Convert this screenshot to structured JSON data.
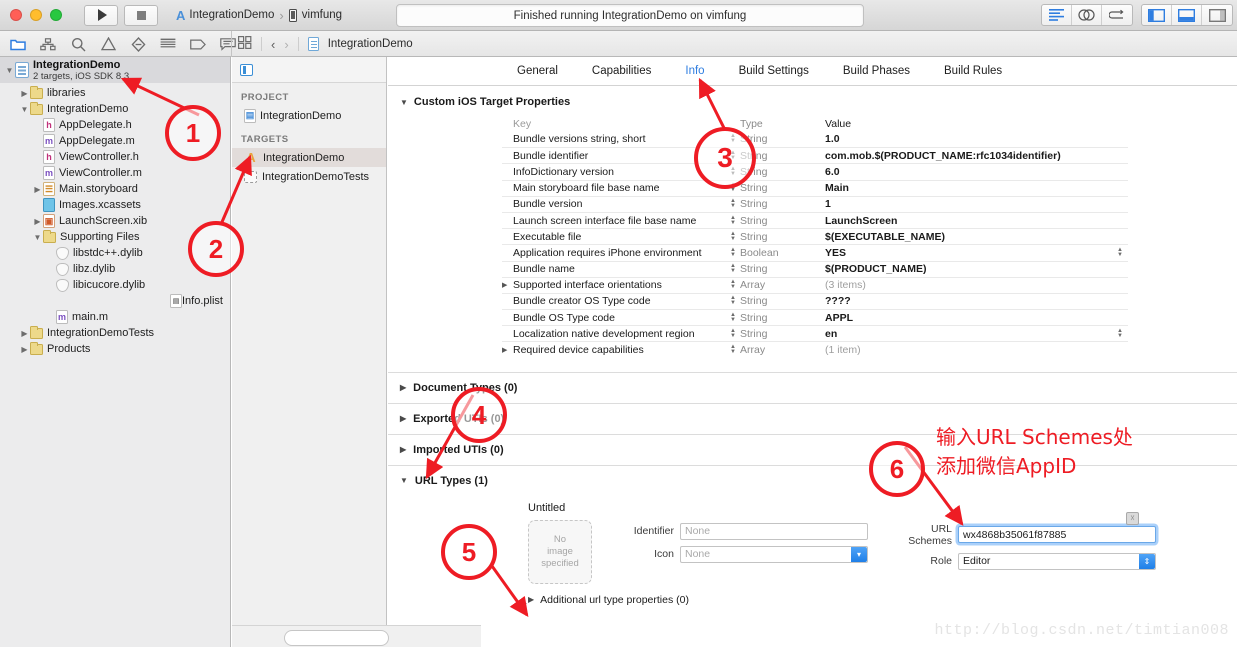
{
  "window": {
    "status_text": "Finished running IntegrationDemo on vimfung",
    "scheme_name": "IntegrationDemo",
    "destination_name": "vimfung"
  },
  "jumpbar": {
    "breadcrumb": "IntegrationDemo"
  },
  "navigator": {
    "project_title": "IntegrationDemo",
    "project_subtitle": "2 targets, iOS SDK 8.3",
    "tree": [
      {
        "label": "libraries",
        "indent": 1,
        "disc": "right",
        "icon": "folder"
      },
      {
        "label": "IntegrationDemo",
        "indent": 1,
        "disc": "down",
        "icon": "folder"
      },
      {
        "label": "AppDelegate.h",
        "indent": 2,
        "disc": "none",
        "icon": "h"
      },
      {
        "label": "AppDelegate.m",
        "indent": 2,
        "disc": "none",
        "icon": "m"
      },
      {
        "label": "ViewController.h",
        "indent": 2,
        "disc": "none",
        "icon": "h"
      },
      {
        "label": "ViewController.m",
        "indent": 2,
        "disc": "none",
        "icon": "m"
      },
      {
        "label": "Main.storyboard",
        "indent": 2,
        "disc": "right",
        "icon": "sb"
      },
      {
        "label": "Images.xcassets",
        "indent": 2,
        "disc": "none",
        "icon": "xca"
      },
      {
        "label": "LaunchScreen.xib",
        "indent": 2,
        "disc": "right",
        "icon": "xib"
      },
      {
        "label": "Supporting Files",
        "indent": 2,
        "disc": "down",
        "icon": "folder"
      },
      {
        "label": "libstdc++.dylib",
        "indent": 3,
        "disc": "none",
        "icon": "dylib"
      },
      {
        "label": "libz.dylib",
        "indent": 3,
        "disc": "none",
        "icon": "dylib"
      },
      {
        "label": "libicucore.dylib",
        "indent": 3,
        "disc": "none",
        "icon": "dylib"
      },
      {
        "label": "Info.plist",
        "indent": 3,
        "disc": "none",
        "icon": "plist"
      },
      {
        "label": "main.m",
        "indent": 3,
        "disc": "none",
        "icon": "m"
      },
      {
        "label": "IntegrationDemoTests",
        "indent": 1,
        "disc": "right",
        "icon": "folder"
      },
      {
        "label": "Products",
        "indent": 1,
        "disc": "right",
        "icon": "folder"
      }
    ]
  },
  "targets_pane": {
    "project_header": "PROJECT",
    "project_item": "IntegrationDemo",
    "targets_header": "TARGETS",
    "targets": [
      {
        "label": "IntegrationDemo",
        "selected": true,
        "icon": "target"
      },
      {
        "label": "IntegrationDemoTests",
        "selected": false,
        "icon": "test"
      }
    ]
  },
  "editor": {
    "tabs": [
      {
        "label": "General",
        "active": false
      },
      {
        "label": "Capabilities",
        "active": false
      },
      {
        "label": "Info",
        "active": true
      },
      {
        "label": "Build Settings",
        "active": false
      },
      {
        "label": "Build Phases",
        "active": false
      },
      {
        "label": "Build Rules",
        "active": false
      }
    ],
    "custom_props_title": "Custom iOS Target Properties",
    "table_headers": {
      "key": "Key",
      "type": "Type",
      "value": "Value"
    },
    "rows": [
      {
        "key": "Bundle versions string, short",
        "type": "String",
        "value": "1.0",
        "dim": false,
        "expandable": false,
        "value_stepper": false
      },
      {
        "key": "Bundle identifier",
        "type": "String",
        "value": "com.mob.$(PRODUCT_NAME:rfc1034identifier)",
        "dim": false,
        "expandable": false,
        "value_stepper": false
      },
      {
        "key": "InfoDictionary version",
        "type": "String",
        "value": "6.0",
        "dim": false,
        "expandable": false,
        "value_stepper": false
      },
      {
        "key": "Main storyboard file base name",
        "type": "String",
        "value": "Main",
        "dim": false,
        "expandable": false,
        "value_stepper": false
      },
      {
        "key": "Bundle version",
        "type": "String",
        "value": "1",
        "dim": false,
        "expandable": false,
        "value_stepper": false
      },
      {
        "key": "Launch screen interface file base name",
        "type": "String",
        "value": "LaunchScreen",
        "dim": false,
        "expandable": false,
        "value_stepper": false
      },
      {
        "key": "Executable file",
        "type": "String",
        "value": "$(EXECUTABLE_NAME)",
        "dim": false,
        "expandable": false,
        "value_stepper": false
      },
      {
        "key": "Application requires iPhone environment",
        "type": "Boolean",
        "value": "YES",
        "dim": false,
        "expandable": false,
        "value_stepper": true
      },
      {
        "key": "Bundle name",
        "type": "String",
        "value": "$(PRODUCT_NAME)",
        "dim": false,
        "expandable": false,
        "value_stepper": false
      },
      {
        "key": "Supported interface orientations",
        "type": "Array",
        "value": "(3 items)",
        "dim": true,
        "expandable": true,
        "value_stepper": false
      },
      {
        "key": "Bundle creator OS Type code",
        "type": "String",
        "value": "????",
        "dim": false,
        "expandable": false,
        "value_stepper": false
      },
      {
        "key": "Bundle OS Type code",
        "type": "String",
        "value": "APPL",
        "dim": false,
        "expandable": false,
        "value_stepper": false
      },
      {
        "key": "Localization native development region",
        "type": "String",
        "value": "en",
        "dim": false,
        "expandable": false,
        "value_stepper": true
      },
      {
        "key": "Required device capabilities",
        "type": "Array",
        "value": "(1 item)",
        "dim": true,
        "expandable": true,
        "value_stepper": false
      }
    ],
    "sections": [
      {
        "label": "Document Types (0)",
        "open": false
      },
      {
        "label": "Exported UTIs (0)",
        "open": false
      },
      {
        "label": "Imported UTIs (0)",
        "open": false
      },
      {
        "label": "URL Types (1)",
        "open": true
      }
    ],
    "url_type": {
      "title": "Untitled",
      "no_image_text": "No\nimage\nspecified",
      "identifier_label": "Identifier",
      "identifier_value": "None",
      "icon_label": "Icon",
      "icon_value": "None",
      "url_schemes_label": "URL Schemes",
      "url_schemes_value": "wx4868b35061f87885",
      "role_label": "Role",
      "role_value": "Editor",
      "additional_label": "Additional url type properties (0)"
    }
  },
  "annotations": {
    "markers": [
      "1",
      "2",
      "3",
      "4",
      "5",
      "6"
    ],
    "note_line1": "输入URL Schemes处",
    "note_line2": "添加微信AppID",
    "color": "#ee1c24"
  },
  "watermark": "http://blog.csdn.net/timtian008"
}
